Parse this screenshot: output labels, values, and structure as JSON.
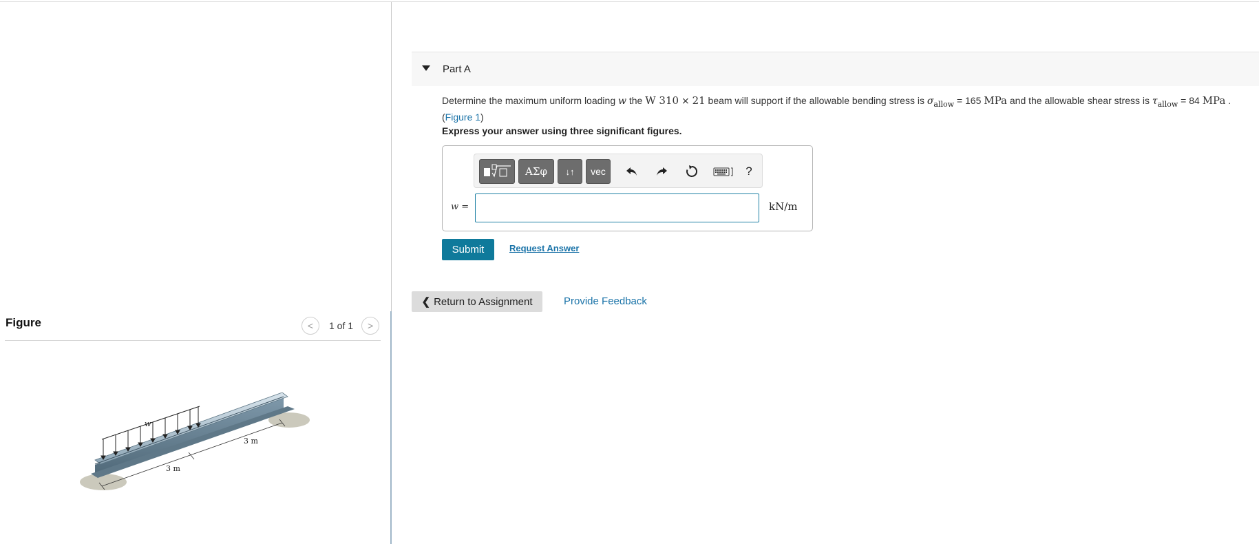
{
  "figure_pane": {
    "title": "Figure",
    "page_indicator": "1 of 1",
    "prev_symbol": "<",
    "next_symbol": ">",
    "diagram": {
      "load_label": "w",
      "span_left": "3 m",
      "span_right": "3 m"
    }
  },
  "part": {
    "label": "Part A",
    "question": {
      "t1": "Determine the maximum uniform loading ",
      "var": "w",
      "t2": " the ",
      "section": "W 310",
      "times": "×",
      "section_size": "21",
      "t3": " beam will support if the allowable bending stress is ",
      "sigma": "σ",
      "allow_sub": "allow",
      "eq1": " = 165 ",
      "unit1": "MPa",
      "t4": " and the allowable shear stress is ",
      "tau": "τ",
      "eq2": " = 84 ",
      "unit2": "MPa",
      "t5": " .",
      "figure_link": "Figure 1",
      "open_paren": "(",
      "close_paren": ")"
    },
    "instruction": "Express your answer using three significant figures.",
    "toolbar": {
      "templates_icon": "sqrt-template-icon",
      "greek_label": "ΑΣφ",
      "arrows_label": "↓↑",
      "vec_label": "vec",
      "undo_icon": "undo-icon",
      "redo_icon": "redo-icon",
      "reset_icon": "reset-icon",
      "keyboard_icon": "keyboard-icon",
      "help_label": "?"
    },
    "answer": {
      "variable_label": "w =",
      "value": "",
      "unit": "kN/m"
    },
    "submit_label": "Submit",
    "request_answer_label": "Request Answer"
  },
  "footer": {
    "return_label": "Return to Assignment",
    "feedback_label": "Provide Feedback"
  },
  "colors": {
    "accent": "#0f7a9b",
    "link": "#1a73a8"
  }
}
